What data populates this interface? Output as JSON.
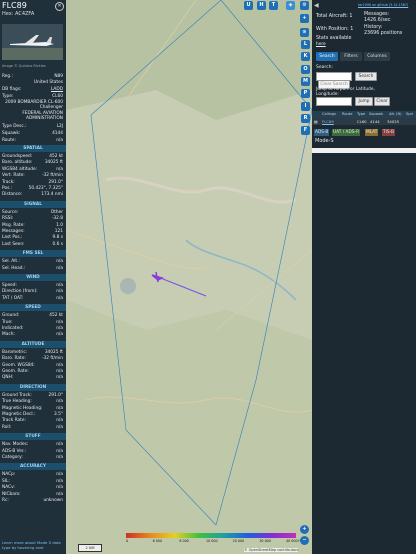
{
  "aircraft": {
    "callsign": "FLC89",
    "hex_label": "Hex:",
    "hex": "AC4ZFA",
    "photo_caption": "Image © Quintus Rickles",
    "registration": "N89",
    "country": "United States",
    "dbflags": "LADD",
    "type": "CL60",
    "type_desc_text": "2009 BOMBARDIER CL-600 Challenger",
    "owner": "FEDERAL AVIATION ADMINISTRATION",
    "type_desc_code": "L2J",
    "squawk": "4144",
    "route": "n/a"
  },
  "labels": {
    "reg": "Reg.:",
    "dbflags": "DB flags:",
    "type": "Type:",
    "typedesc": "Type Desc.:",
    "squawk": "Squawk:",
    "route": "Route:"
  },
  "sections": [
    {
      "title": "SPATIAL",
      "rows": [
        [
          "Groundspeed:",
          "452 kt"
        ],
        [
          "Baro. altitude:",
          "34025 ft"
        ],
        [
          "WGS84 altitude:",
          "n/a"
        ],
        [
          "Vert. Rate:",
          "-32 ft/min"
        ],
        [
          "Track:",
          "291.0°"
        ],
        [
          "Pos.:",
          "50.423°, 7.325°"
        ],
        [
          "Distance:",
          "173.4 nmi"
        ]
      ]
    },
    {
      "title": "SIGNAL",
      "rows": [
        [
          "Source:",
          "Other"
        ],
        [
          "RSSI:",
          "-32.8"
        ],
        [
          "Msg. Rate:",
          "1.0"
        ],
        [
          "Messages:",
          "121"
        ],
        [
          "Last Pos.:",
          "9.8 s"
        ],
        [
          "Last Seen:",
          "0.6 s"
        ]
      ]
    },
    {
      "title": "FMS SEL",
      "rows": [
        [
          "Sel. Alt.:",
          "n/a"
        ],
        [
          "Sel. Head.:",
          "n/a"
        ]
      ]
    },
    {
      "title": "WIND",
      "rows": [
        [
          "Speed:",
          "n/a"
        ],
        [
          "Direction (from):",
          "n/a"
        ],
        [
          "TAT / OAT:",
          "n/a"
        ]
      ]
    },
    {
      "title": "SPEED",
      "rows": [
        [
          "Ground:",
          "452 kt"
        ],
        [
          "True:",
          "n/a"
        ],
        [
          "Indicated:",
          "n/a"
        ],
        [
          "Mach:",
          "n/a"
        ]
      ]
    },
    {
      "title": "ALTITUDE",
      "rows": [
        [
          "Barometric:",
          "34025 ft"
        ],
        [
          "Baro. Rate:",
          "-32 ft/min"
        ],
        [
          "Geom. WGS84:",
          "n/a"
        ],
        [
          "Geom. Rate:",
          "n/a"
        ],
        [
          "QNH:",
          "n/a"
        ]
      ]
    },
    {
      "title": "DIRECTION",
      "rows": [
        [
          "Ground Track:",
          "291.0°"
        ],
        [
          "True Heading:",
          "n/a"
        ],
        [
          "Magnetic Heading:",
          "n/a"
        ],
        [
          "Magnetic Decl.:",
          "3.5°"
        ],
        [
          "Track Rate:",
          "n/a"
        ],
        [
          "Roll:",
          "n/a"
        ]
      ]
    },
    {
      "title": "STUFF",
      "rows": [
        [
          "Nav. Modes:",
          "n/a"
        ],
        [
          "ADS-B Ver.:",
          "n/a"
        ],
        [
          "Category:",
          "n/a"
        ]
      ]
    },
    {
      "title": "ACCURACY",
      "rows": [
        [
          "NACp:",
          "n/a"
        ],
        [
          "SIL:",
          "n/a"
        ],
        [
          "NACv:",
          "n/a"
        ],
        [
          "NICbaro:",
          "n/a"
        ],
        [
          "Rc:",
          "unknown"
        ]
      ]
    }
  ],
  "footer_link": "Learn more about Mode S data type by hovering over",
  "map": {
    "top_buttons": [
      "U",
      "H",
      "T"
    ],
    "side_buttons": [
      "L",
      "K",
      "O",
      "M",
      "P",
      "I",
      "R",
      "F"
    ],
    "zoom_in": "+",
    "zoom_out": "−",
    "scale_label": "2 NM",
    "attribution": "© OpenStreetMap contributors",
    "colorscale_labels": [
      "0",
      "6 000",
      "8 000",
      "10 000",
      "20 000",
      "30 000",
      "40 000+"
    ],
    "colors": {
      "plane": "#8a3dd8",
      "trail": "#7a52e8",
      "boundary": "#2f7fbf",
      "water": "#8fb6c9"
    }
  },
  "right": {
    "toplink": "tar1090 on github (3.14.1587)",
    "stats": {
      "total_aircraft_label": "Total Aircraft:",
      "total_aircraft": "1",
      "with_position_label": "With Position:",
      "with_position": "1",
      "stats_label": "Stats available",
      "stats_link": "here",
      "messages_label": "Messages:",
      "messages": "1426.6/sec",
      "history_label": "History:",
      "history": "23696 positions"
    },
    "tabs": [
      "Search",
      "Filters",
      "Columns"
    ],
    "search_label": "Search:",
    "search_button": "Search",
    "clear_button": "Clear Search",
    "jump_label": "Jump to Airport or Latitude, Longitude:",
    "jump_button": "Jump",
    "clear2_button": "Clear",
    "table_headers": [
      "Callsign",
      "Route",
      "Type",
      "Squawk",
      "Alt. (ft)",
      "Spd"
    ],
    "table_row": [
      "FLC89",
      "",
      "CL60",
      "4144",
      "34025",
      ""
    ],
    "legend": [
      {
        "label": "ADS-B",
        "color": "#2e5f7f"
      },
      {
        "label": "UAT / ADS-R",
        "color": "#3c6c3c"
      },
      {
        "label": "MLAT",
        "color": "#8a6f2f"
      },
      {
        "label": "TIS-B",
        "color": "#8a3f3f"
      }
    ],
    "mode_s": "Mode-S"
  }
}
